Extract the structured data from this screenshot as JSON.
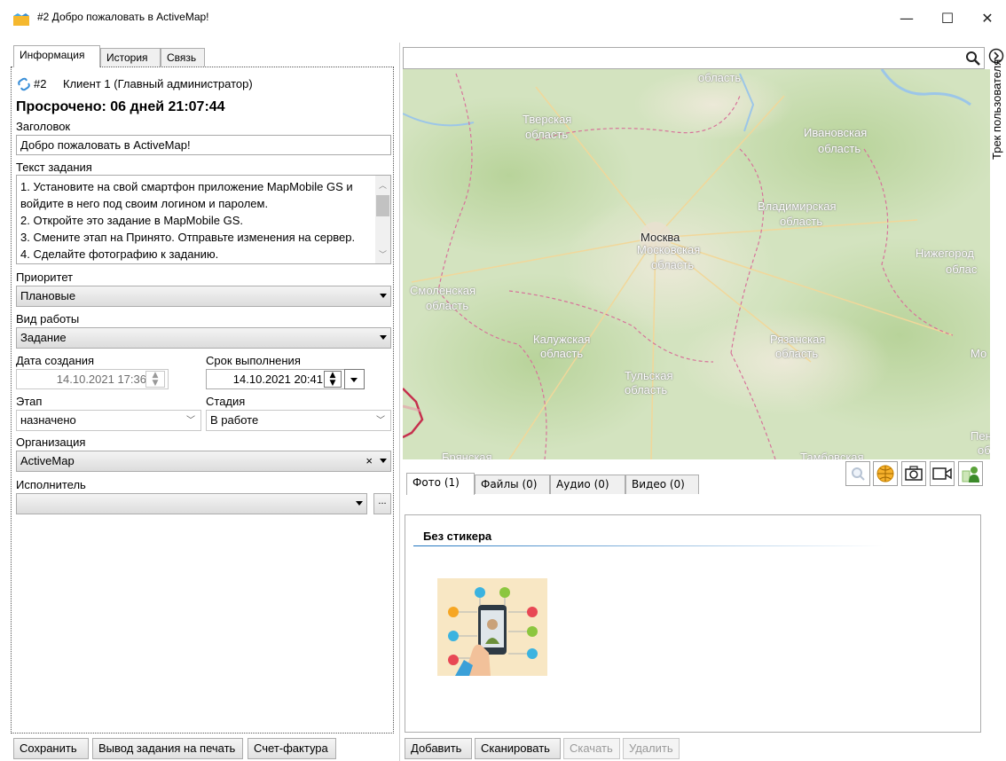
{
  "window": {
    "title": "#2 Добро пожаловать в ActiveMap!",
    "minimize": "—",
    "maximize": "☐",
    "close": "✕"
  },
  "left_tabs": [
    "Информация",
    "История",
    "Связь"
  ],
  "task": {
    "number": "#2",
    "client": "Клиент 1 (Главный администратор)",
    "overdue": "Просрочено: 06 дней 21:07:44",
    "title_label": "Заголовок",
    "title_value": "Добро пожаловать в ActiveMap!",
    "text_label": "Текст задания",
    "text_lines": [
      "1. Установите на свой смартфон приложение MapMobile GS и",
      "войдите в него под своим логином и паролем.",
      "2. Откройте это задание в MapMobile GS.",
      "3. Смените этап на Принято. Отправьте изменения на сервер.",
      "4. Сделайте фотографию к заданию."
    ],
    "priority_label": "Приоритет",
    "priority_value": "Плановые",
    "worktype_label": "Вид работы",
    "worktype_value": "Задание",
    "created_label": "Дата создания",
    "created_value": "14.10.2021 17:36",
    "deadline_label": "Срок выполнения",
    "deadline_value": "14.10.2021 20:41",
    "stage_label": "Этап",
    "stage_value": "назначено",
    "status_label": "Стадия",
    "status_value": "В работе",
    "org_label": "Организация",
    "org_value": "ActiveMap",
    "org_clear": "×",
    "executor_label": "Исполнитель",
    "executor_value": "",
    "executor_more": "..."
  },
  "left_buttons": {
    "save": "Сохранить",
    "print": "Вывод задания на печать",
    "invoice": "Счет-фактура"
  },
  "search": {
    "value": "",
    "placeholder": ""
  },
  "side_panel_label": "Трек пользователя",
  "map_labels": {
    "oblast_top": "область",
    "tver1": "Тверская",
    "tver2": "область",
    "ivanovo1": "Ивановская",
    "ivanovo2": "область",
    "vladimir1": "Владимирская",
    "vladimir2": "область",
    "moscow": "Москва",
    "moscow_obl1": "Московская",
    "moscow_obl2": "область",
    "nizhny1": "Нижегород",
    "nizhny2": "облас",
    "smolensk1": "Смоленская",
    "smolensk2": "область",
    "kaluga1": "Калужская",
    "kaluga2": "область",
    "ryazan1": "Рязанская",
    "ryazan2": "область",
    "tula1": "Тульская",
    "tula2": "область",
    "mo_right": "Мо",
    "penza1": "Пен",
    "penza2": "об",
    "bryansk": "Брянская",
    "tambov": "Тамбовская"
  },
  "media_tabs": [
    "Фото (1)",
    "Файлы (0)",
    "Аудио (0)",
    "Видео (0)"
  ],
  "sticker_header": "Без стикера",
  "media_buttons": {
    "add": "Добавить",
    "scan": "Сканировать",
    "download": "Скачать",
    "delete": "Удалить"
  },
  "colors": {
    "accent": "#1e73be",
    "map_green": "#cddfb4",
    "region_border": "#c04a6a"
  }
}
